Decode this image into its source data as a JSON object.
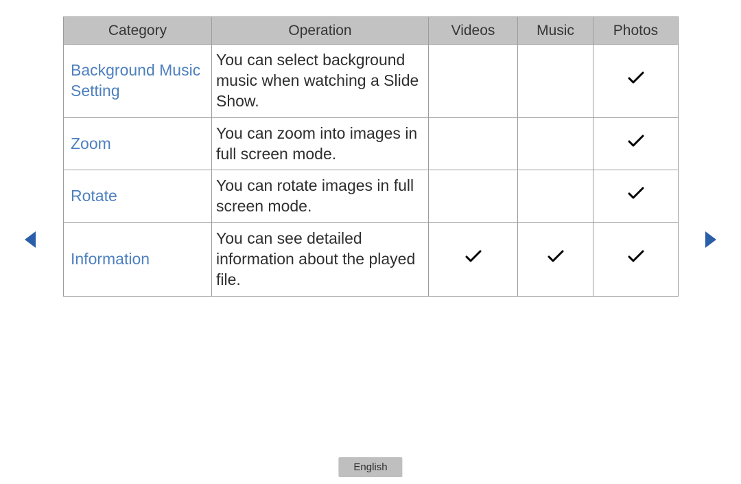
{
  "headers": {
    "category": "Category",
    "operation": "Operation",
    "videos": "Videos",
    "music": "Music",
    "photos": "Photos"
  },
  "rows": [
    {
      "category": "Background Music Setting",
      "operation": "You can select background music when watching a Slide Show.",
      "videos": false,
      "music": false,
      "photos": true
    },
    {
      "category": "Zoom",
      "operation": "You can zoom into images in full screen mode.",
      "videos": false,
      "music": false,
      "photos": true
    },
    {
      "category": "Rotate",
      "operation": "You can rotate images in full screen mode.",
      "videos": false,
      "music": false,
      "photos": true
    },
    {
      "category": "Information",
      "operation": "You can see detailed information about the played file.",
      "videos": true,
      "music": true,
      "photos": true
    }
  ],
  "language": "English"
}
